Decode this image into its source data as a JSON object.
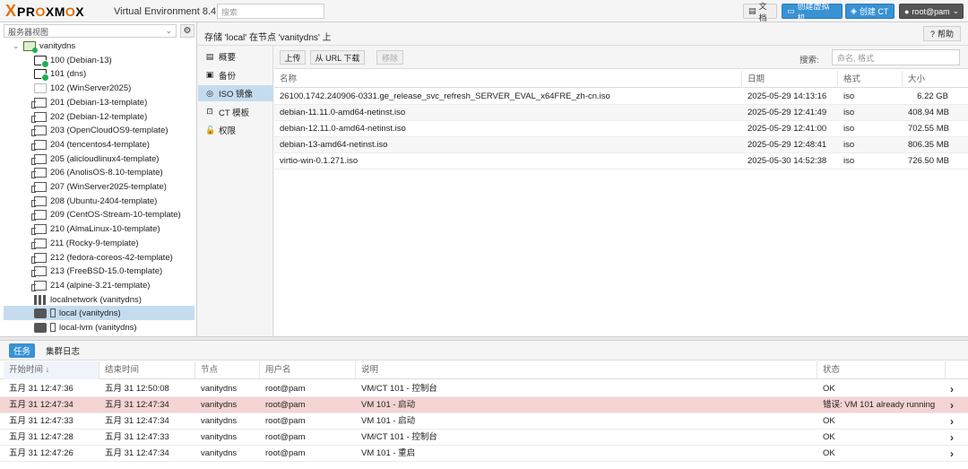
{
  "header": {
    "logo_x": "X",
    "logo_word": "PROXMOX",
    "version": "Virtual Environment 8.4.1",
    "search_placeholder": "搜索",
    "docs_label": "文档",
    "create_vm_label": "创建虚拟机",
    "create_ct_label": "创建 CT",
    "user_label": "root@pam"
  },
  "tree": {
    "view_label": "服务器视图",
    "node": "vanitydns",
    "items": [
      {
        "label": "100 (Debian-13)",
        "kind": "vm-run"
      },
      {
        "label": "101 (dns)",
        "kind": "vm-run"
      },
      {
        "label": "102 (WinServer2025)",
        "kind": "vm-stopped"
      },
      {
        "label": "201 (Debian-13-template)",
        "kind": "tpl"
      },
      {
        "label": "202 (Debian-12-template)",
        "kind": "tpl"
      },
      {
        "label": "203 (OpenCloudOS9-template)",
        "kind": "tpl"
      },
      {
        "label": "204 (tencentos4-template)",
        "kind": "tpl"
      },
      {
        "label": "205 (alicloudlinux4-template)",
        "kind": "tpl"
      },
      {
        "label": "206 (AnolisOS-8.10-template)",
        "kind": "tpl"
      },
      {
        "label": "207 (WinServer2025-template)",
        "kind": "tpl"
      },
      {
        "label": "208 (Ubuntu-2404-template)",
        "kind": "tpl"
      },
      {
        "label": "209 (CentOS-Stream-10-template)",
        "kind": "tpl"
      },
      {
        "label": "210 (AlmaLinux-10-template)",
        "kind": "tpl"
      },
      {
        "label": "211 (Rocky-9-template)",
        "kind": "tpl"
      },
      {
        "label": "212 (fedora-coreos-42-template)",
        "kind": "tpl"
      },
      {
        "label": "213 (FreeBSD-15.0-template)",
        "kind": "tpl"
      },
      {
        "label": "214 (alpine-3.21-template)",
        "kind": "tpl"
      },
      {
        "label": "localnetwork (vanitydns)",
        "kind": "net"
      },
      {
        "label": "local (vanitydns)",
        "kind": "store",
        "selected": true
      },
      {
        "label": "local-lvm (vanitydns)",
        "kind": "store"
      }
    ]
  },
  "content": {
    "title": "存储 'local' 在节点 'vanitydns' 上",
    "help_label": "帮助",
    "nav": [
      {
        "label": "概要",
        "icon": "book-icon"
      },
      {
        "label": "备份",
        "icon": "floppy-icon"
      },
      {
        "label": "ISO 镜像",
        "icon": "disc-icon",
        "active": true
      },
      {
        "label": "CT 模板",
        "icon": "template-icon"
      },
      {
        "label": "权限",
        "icon": "unlock-icon"
      }
    ],
    "toolbar": {
      "upload": "上传",
      "download_url": "从 URL 下载",
      "remove": "移除",
      "search_label": "搜索:",
      "search_placeholder": "命名, 格式"
    },
    "columns": [
      "名称",
      "日期",
      "格式",
      "大小"
    ],
    "rows": [
      {
        "name": "26100.1742.240906-0331.ge_release_svc_refresh_SERVER_EVAL_x64FRE_zh-cn.iso",
        "date": "2025-05-29 14:13:16",
        "format": "iso",
        "size": "6.22 GB"
      },
      {
        "name": "debian-11.11.0-amd64-netinst.iso",
        "date": "2025-05-29 12:41:49",
        "format": "iso",
        "size": "408.94 MB"
      },
      {
        "name": "debian-12.11.0-amd64-netinst.iso",
        "date": "2025-05-29 12:41:00",
        "format": "iso",
        "size": "702.55 MB"
      },
      {
        "name": "debian-13-amd64-netinst.iso",
        "date": "2025-05-29 12:48:41",
        "format": "iso",
        "size": "806.35 MB"
      },
      {
        "name": "virtio-win-0.1.271.iso",
        "date": "2025-05-30 14:52:38",
        "format": "iso",
        "size": "726.50 MB"
      }
    ]
  },
  "log": {
    "tabs": [
      "任务",
      "集群日志"
    ],
    "columns": [
      "开始时间 ↓",
      "结束时间",
      "节点",
      "用户名",
      "说明",
      "状态"
    ],
    "rows": [
      {
        "start": "五月 31 12:47:36",
        "end": "五月 31 12:50:08",
        "node": "vanitydns",
        "user": "root@pam",
        "desc": "VM/CT 101 - 控制台",
        "status": "OK",
        "error": false
      },
      {
        "start": "五月 31 12:47:34",
        "end": "五月 31 12:47:34",
        "node": "vanitydns",
        "user": "root@pam",
        "desc": "VM 101 - 启动",
        "status": "错误: VM 101 already running",
        "error": true
      },
      {
        "start": "五月 31 12:47:33",
        "end": "五月 31 12:47:34",
        "node": "vanitydns",
        "user": "root@pam",
        "desc": "VM 101 - 启动",
        "status": "OK",
        "error": false
      },
      {
        "start": "五月 31 12:47:28",
        "end": "五月 31 12:47:33",
        "node": "vanitydns",
        "user": "root@pam",
        "desc": "VM/CT 101 - 控制台",
        "status": "OK",
        "error": false
      },
      {
        "start": "五月 31 12:47:26",
        "end": "五月 31 12:47:34",
        "node": "vanitydns",
        "user": "root@pam",
        "desc": "VM 101 - 重启",
        "status": "OK",
        "error": false
      }
    ]
  },
  "colors": {
    "accent": "#3892d4",
    "logo_orange": "#e57000",
    "selection": "#c5dcef",
    "error_row": "#f4d3d3",
    "running_green": "#20b050"
  }
}
